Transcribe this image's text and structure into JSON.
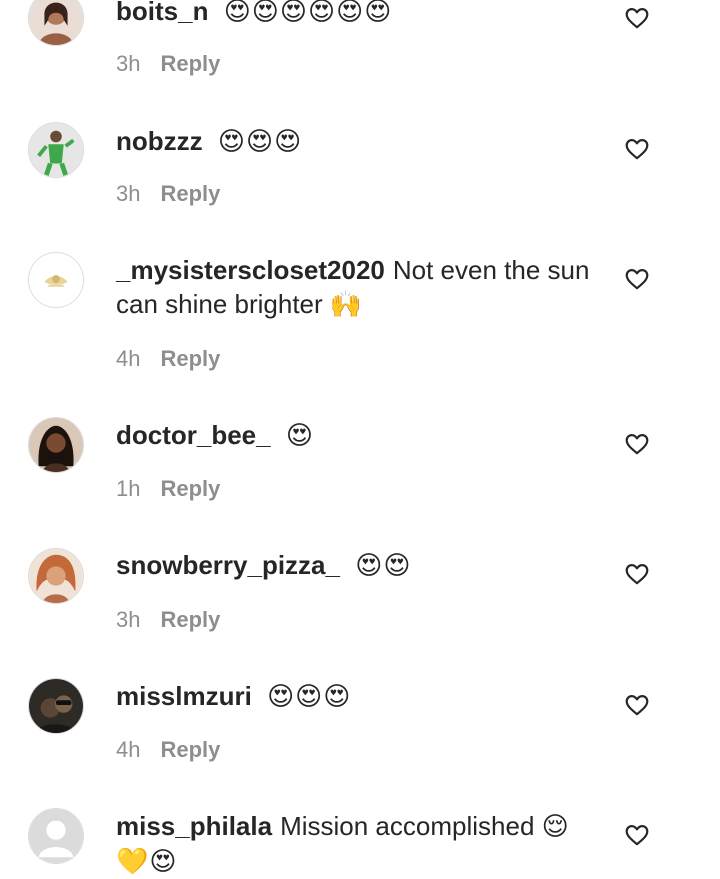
{
  "comments": [
    {
      "username": "boits_n",
      "message": "",
      "emoji": "😍😍😍😍😍😍",
      "time": "3h",
      "reply": "Reply",
      "avatar_color": "#b07a5a"
    },
    {
      "username": "nobzzz",
      "message": "",
      "emoji": "😍😍😍",
      "time": "3h",
      "reply": "Reply",
      "avatar_color": "#3fa84a"
    },
    {
      "username": "_mysisterscloset2020",
      "message": "Not even the sun can shine brighter",
      "emoji": "🙌",
      "time": "4h",
      "reply": "Reply",
      "avatar_color": "#e8d39a"
    },
    {
      "username": "doctor_bee_",
      "message": "",
      "emoji": "😍",
      "time": "1h",
      "reply": "Reply",
      "avatar_color": "#4a2e22"
    },
    {
      "username": "snowberry_pizza_",
      "message": "",
      "emoji": "😍😍",
      "time": "3h",
      "reply": "Reply",
      "avatar_color": "#c46a3a"
    },
    {
      "username": "misslmzuri",
      "message": "",
      "emoji": "😍😍😍",
      "time": "4h",
      "reply": "Reply",
      "avatar_color": "#2e2a26"
    },
    {
      "username": "miss_philala",
      "message": "Mission accomplished",
      "emoji": "😌 💛😍",
      "time": "",
      "reply": "",
      "avatar_color": "#dbdbdb"
    }
  ],
  "colors": {
    "text": "#262626",
    "muted": "#8e8e8e",
    "border": "#dbdbdb"
  }
}
